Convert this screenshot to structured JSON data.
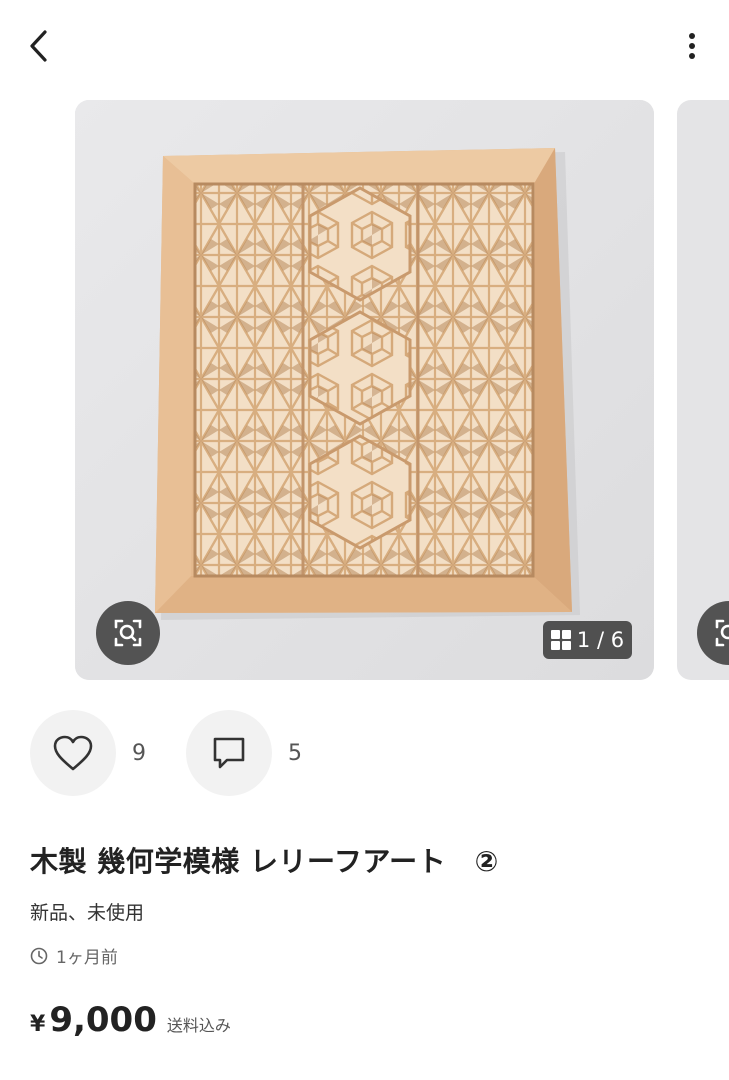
{
  "header": {
    "back_icon": "chevron-left-icon",
    "menu_icon": "more-vertical-icon"
  },
  "gallery": {
    "counter": "1 / 6",
    "current_image": "Wooden frame with kumiko asanoha and hexagonal geometric relief pattern",
    "zoom_icon": "image-search-icon"
  },
  "actions": {
    "like_count": "9",
    "comment_count": "5"
  },
  "product": {
    "title": "木製 幾何学模様 レリーフアート　②",
    "condition": "新品、未使用",
    "posted": "1ヶ月前",
    "price_symbol": "¥",
    "price": "9,000",
    "shipping": "送料込み"
  },
  "colors": {
    "wood_light": "#e8c7a0",
    "wood_frame": "#e2b78c",
    "wall": "#e4e4e6",
    "overlay_dark": "#464646"
  }
}
